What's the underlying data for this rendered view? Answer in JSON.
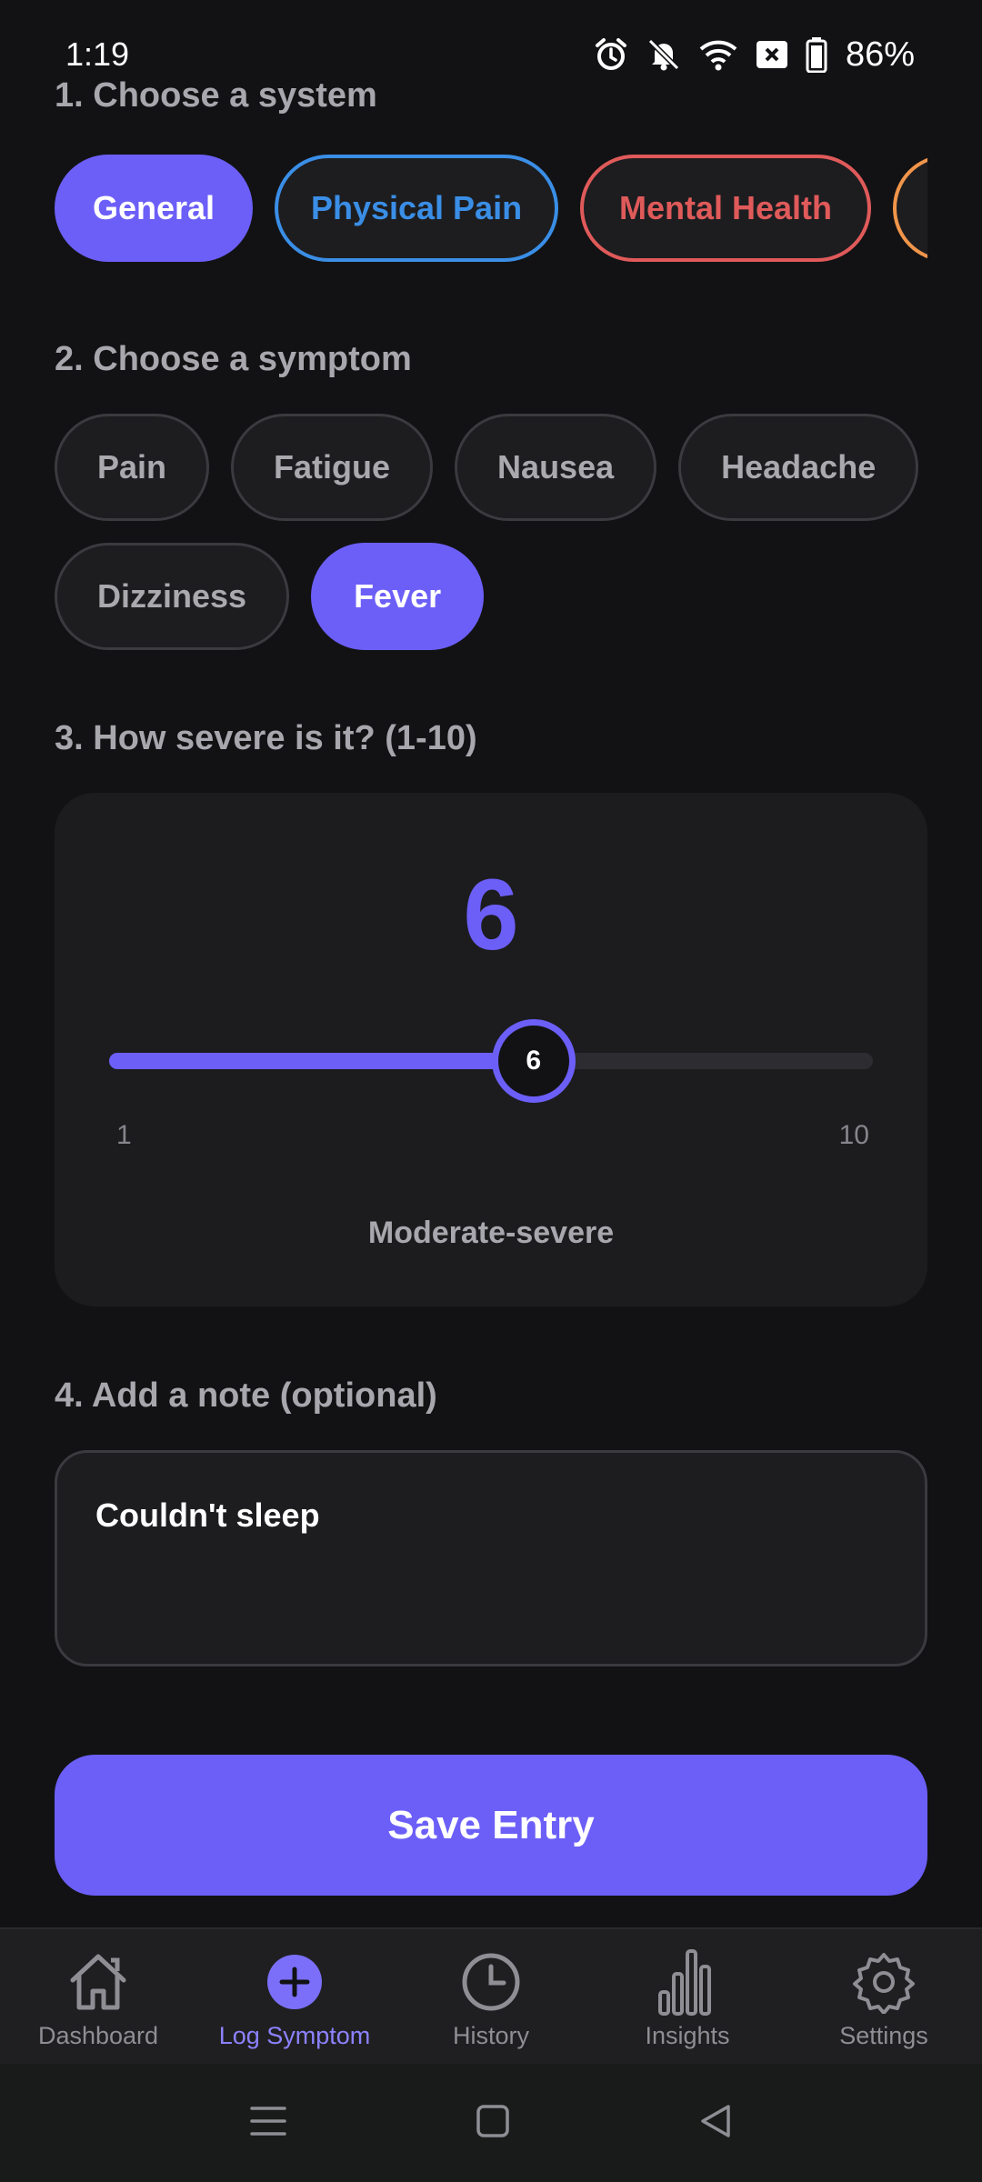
{
  "status_bar": {
    "time": "1:19",
    "battery": "86%"
  },
  "sections": {
    "system_title": "1. Choose a system",
    "symptom_title": "2. Choose a symptom",
    "severity_title": "3. How severe is it? (1-10)",
    "note_title": "4. Add a note (optional)"
  },
  "systems": [
    {
      "label": "General",
      "selected": true,
      "color": "#6c5ff8"
    },
    {
      "label": "Physical Pain",
      "selected": false,
      "color": "#3a8ee6"
    },
    {
      "label": "Mental Health",
      "selected": false,
      "color": "#e05a5a"
    },
    {
      "label": "",
      "selected": false,
      "color": "#f0954a"
    }
  ],
  "symptoms": [
    {
      "label": "Pain",
      "selected": false
    },
    {
      "label": "Fatigue",
      "selected": false
    },
    {
      "label": "Nausea",
      "selected": false
    },
    {
      "label": "Headache",
      "selected": false
    },
    {
      "label": "Dizziness",
      "selected": false
    },
    {
      "label": "Fever",
      "selected": true
    }
  ],
  "severity": {
    "value": "6",
    "min_label": "1",
    "max_label": "10",
    "level": 6,
    "min": 1,
    "max": 10,
    "description": "Moderate-severe"
  },
  "note": {
    "value": "Couldn't sleep"
  },
  "save_button": {
    "label": "Save Entry"
  },
  "bottom_nav": [
    {
      "label": "Dashboard",
      "icon": "home-icon",
      "active": false
    },
    {
      "label": "Log Symptom",
      "icon": "plus-circle-icon",
      "active": true
    },
    {
      "label": "History",
      "icon": "clock-icon",
      "active": false
    },
    {
      "label": "Insights",
      "icon": "bar-chart-icon",
      "active": false
    },
    {
      "label": "Settings",
      "icon": "gear-icon",
      "active": false
    }
  ],
  "colors": {
    "accent": "#6c5ff8",
    "background": "#121214",
    "card": "#1c1c1f"
  }
}
